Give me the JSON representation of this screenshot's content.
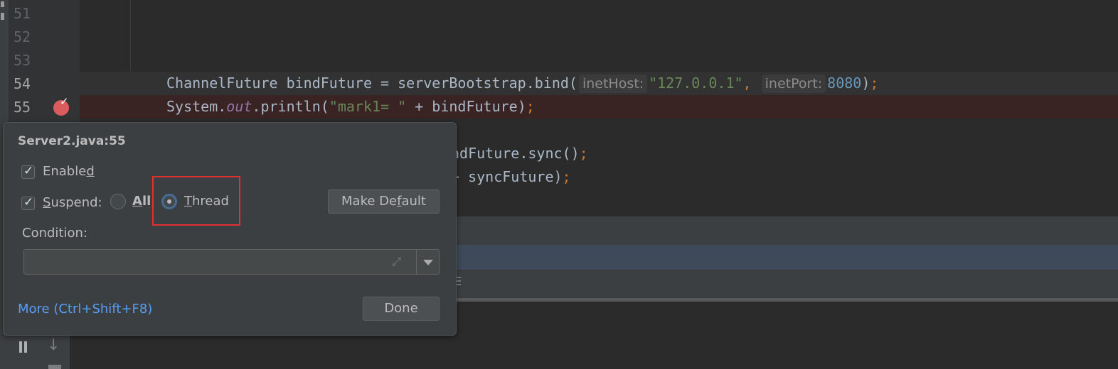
{
  "gutter": {
    "line_numbers": [
      "51",
      "52",
      "53",
      "54",
      "55"
    ]
  },
  "code": {
    "line54": {
      "indent": "",
      "part1": "ChannelFuture bindFuture = serverBootstrap.bind(",
      "hint_host": "inetHost:",
      "host_value": "\"127.0.0.1\"",
      "comma": ", ",
      "hint_port": "inetPort:",
      "port_value": "8080",
      "close": ")",
      "semicolon": ";"
    },
    "line55": {
      "part1": "System.",
      "out": "out",
      "part2": ".println(",
      "string": "\"mark1= \"",
      "part3": " + bindFuture)",
      "semicolon": ";"
    },
    "line57": {
      "text": "ndFuture.sync()",
      "semicolon": ";"
    },
    "line58": {
      "text": "+ syncFuture)",
      "semicolon": ";"
    }
  },
  "popup": {
    "title": "Server2.java:55",
    "enabled_label_pre": "Enable",
    "enabled_label_u": "d",
    "suspend_label_u": "S",
    "suspend_label_post": "uspend:",
    "all_label_u": "A",
    "all_label_post": "ll",
    "thread_label_u": "T",
    "thread_label_post": "hread",
    "make_default_pre": "Make De",
    "make_default_u": "f",
    "make_default_post": "ault",
    "condition_label": "Condition:",
    "condition_value": "",
    "more_link": "More (Ctrl+Shift+F8)",
    "done_label": "Done",
    "enabled_checked": true,
    "suspend_checked": true,
    "suspend_policy": "Thread"
  },
  "colors": {
    "breakpoint": "#db5c5c",
    "link": "#589df6",
    "highlight": "#e03030",
    "string": "#6a8759",
    "number": "#6897bb",
    "keyword": "#cc7832"
  }
}
